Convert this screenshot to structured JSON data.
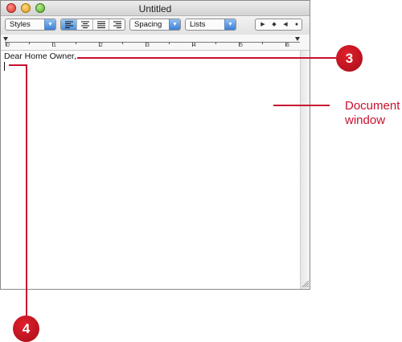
{
  "window": {
    "title": "Untitled"
  },
  "toolbar": {
    "styles_label": "Styles",
    "spacing_label": "Spacing",
    "lists_label": "Lists",
    "alignment": [
      "align-left",
      "align-center",
      "align-justify",
      "align-right"
    ],
    "active_alignment": "align-left"
  },
  "ruler": {
    "numbers": [
      "0",
      "1",
      "2",
      "3",
      "4",
      "5",
      "6"
    ]
  },
  "document": {
    "text": "Dear Home Owner,"
  },
  "callouts": {
    "badge_top": "3",
    "badge_bottom": "4",
    "label_line1": "Document",
    "label_line2": "window"
  },
  "colors": {
    "callout": "#c8102e",
    "accent_blue": "#3d7fd6"
  }
}
